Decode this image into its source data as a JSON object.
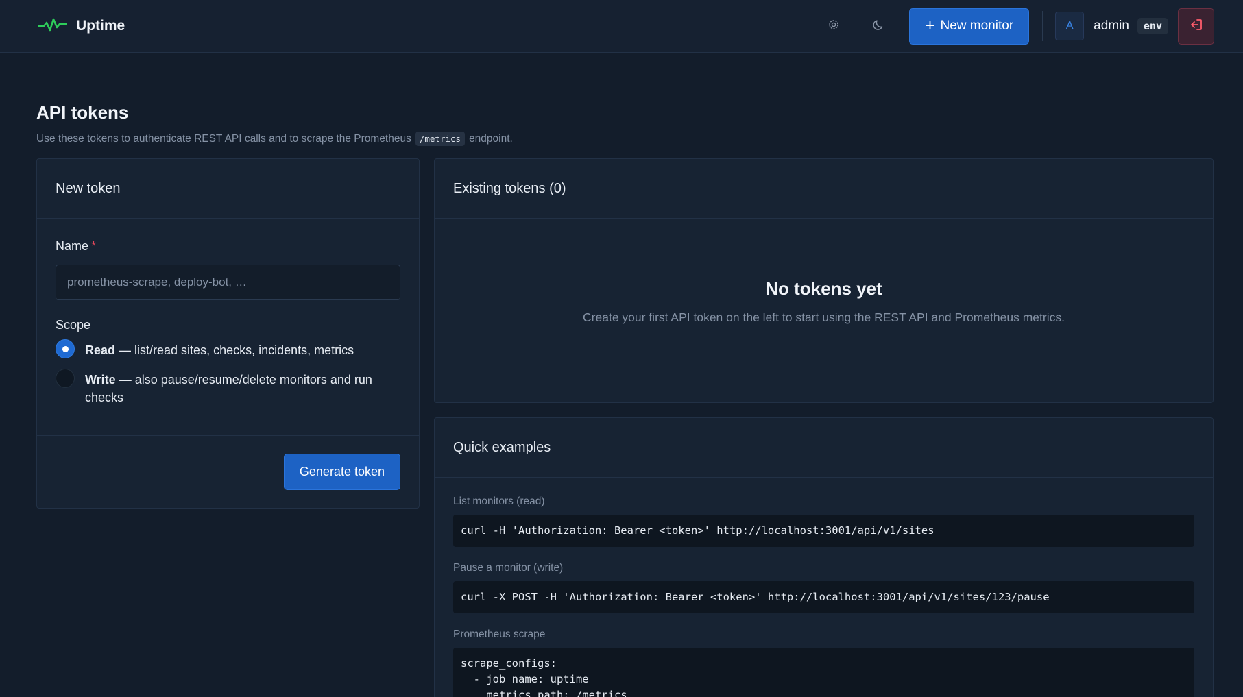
{
  "app": {
    "name": "Uptime"
  },
  "header": {
    "new_monitor_label": "New monitor",
    "avatar_initial": "A",
    "username": "admin",
    "env_badge": "env"
  },
  "page": {
    "title": "API tokens",
    "subtitle_before": "Use these tokens to authenticate REST API calls and to scrape the Prometheus",
    "subtitle_code": "/metrics",
    "subtitle_after": "endpoint."
  },
  "new_token": {
    "heading": "New token",
    "name_label": "Name",
    "required_mark": "*",
    "name_value": "",
    "name_placeholder": "prometheus-scrape, deploy-bot, …",
    "scope_label": "Scope",
    "scopes": [
      {
        "title": "Read",
        "desc": "— list/read sites, checks, incidents, metrics",
        "selected": true
      },
      {
        "title": "Write",
        "desc": "— also pause/resume/delete monitors and run checks",
        "selected": false
      }
    ],
    "generate_label": "Generate token"
  },
  "existing": {
    "heading": "Existing tokens (0)",
    "empty_title": "No tokens yet",
    "empty_sub": "Create your first API token on the left to start using the REST API and Prometheus metrics."
  },
  "examples": {
    "heading": "Quick examples",
    "items": [
      {
        "label": "List monitors (read)",
        "code": "curl -H 'Authorization: Bearer <token>' http://localhost:3001/api/v1/sites"
      },
      {
        "label": "Pause a monitor (write)",
        "code": "curl -X POST -H 'Authorization: Bearer <token>' http://localhost:3001/api/v1/sites/123/pause"
      },
      {
        "label": "Prometheus scrape",
        "code": "scrape_configs:\n  - job_name: uptime\n    metrics_path: /metrics"
      }
    ]
  },
  "colors": {
    "accent": "#1d62c4",
    "brand_pulse": "#2ecc5a",
    "danger": "#ff5c6c",
    "background": "#131d2b"
  },
  "icons": [
    "pulse-logo-icon",
    "settings-gear-icon",
    "moon-icon",
    "plus-icon",
    "logout-icon"
  ]
}
